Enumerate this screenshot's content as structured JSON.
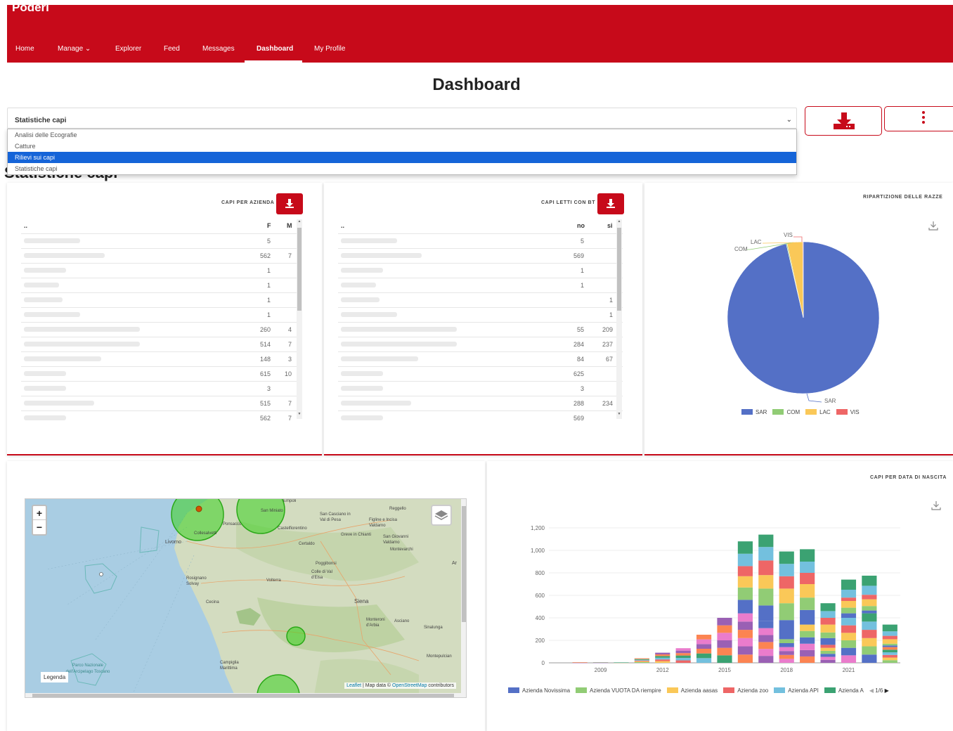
{
  "app": {
    "brand": "Poderi"
  },
  "nav": {
    "items": [
      {
        "label": "Home"
      },
      {
        "label": "Manage"
      },
      {
        "label": "Explorer"
      },
      {
        "label": "Feed"
      },
      {
        "label": "Messages"
      },
      {
        "label": "Dashboard"
      },
      {
        "label": "My Profile"
      }
    ],
    "manage_chevron": "⌄"
  },
  "page": {
    "title": "Dashboard",
    "section_title": "Statistiche capi"
  },
  "selector": {
    "value": "Statistiche capi",
    "chevron": "⌄",
    "options": [
      "Analisi delle Ecografie",
      "Catture",
      "Rilievi sui capi",
      "Statistiche capi"
    ],
    "highlighted": "Rilievi sui capi"
  },
  "colors": {
    "primary": "#c70a1a",
    "selection": "#1564d8"
  },
  "table_azienda": {
    "title": "CAPI PER AZIENDA",
    "col_name": "..",
    "col1": "F",
    "col2": "M",
    "rows": [
      [
        "5",
        ""
      ],
      [
        "562",
        "7"
      ],
      [
        "1",
        ""
      ],
      [
        "1",
        ""
      ],
      [
        "1",
        ""
      ],
      [
        "1",
        ""
      ],
      [
        "260",
        "4"
      ],
      [
        "514",
        "7"
      ],
      [
        "148",
        "3"
      ],
      [
        "615",
        "10"
      ],
      [
        "3",
        ""
      ],
      [
        "515",
        "7"
      ],
      [
        "562",
        "7"
      ]
    ]
  },
  "table_bt": {
    "title": "CAPI LETTI CON BT",
    "col_name": "..",
    "col1": "no",
    "col2": "si",
    "rows": [
      [
        "5",
        ""
      ],
      [
        "569",
        ""
      ],
      [
        "1",
        ""
      ],
      [
        "1",
        ""
      ],
      [
        "",
        "1"
      ],
      [
        "",
        "1"
      ],
      [
        "55",
        "209"
      ],
      [
        "284",
        "237"
      ],
      [
        "84",
        "67"
      ],
      [
        "625",
        ""
      ],
      [
        "3",
        ""
      ],
      [
        "288",
        "234"
      ],
      [
        "569",
        ""
      ]
    ]
  },
  "pie": {
    "title": "RIPARTIZIONE DELLE RAZZE",
    "download_icon": "download-icon"
  },
  "map": {
    "zoom_in": "+",
    "zoom_out": "−",
    "legend_label": "Legenda",
    "attribution_leaflet": "Leaflet",
    "attribution_sep": " | Map data © ",
    "attribution_osm": "OpenStreetMap",
    "attribution_end": " contributors",
    "places": [
      "Empoli",
      "San Miniato",
      "Ponsacco",
      "Castelfiorentino",
      "San Casciano in Val di Pesa",
      "Reggello",
      "Figline e Incisa Valdarno",
      "Greve in Chianti",
      "San Giovanni Valdarno",
      "Montevarchi",
      "Livorno",
      "Collesalvetti",
      "Certaldo",
      "Poggibonsi",
      "Colle di Val d'Elsa",
      "Rosignano Solvay",
      "Volterra",
      "Siena",
      "Cecina",
      "Monteroni d'Arbia",
      "Asciano",
      "Sinalunga",
      "Ar",
      "Campiglia Marittima",
      "Montepulcian",
      "Parco Nazionale dell'Arcipelago Toscano"
    ]
  },
  "chart_data": [
    {
      "type": "pie",
      "title": "RIPARTIZIONE DELLE RAZZE",
      "labels": [
        "SAR",
        "COM",
        "LAC",
        "VIS"
      ],
      "values": [
        2960,
        6,
        101,
        4
      ],
      "colors": [
        "#5470c6",
        "#91cc75",
        "#fac858",
        "#ee6666"
      ],
      "legend": "bottom"
    },
    {
      "type": "bar",
      "stacked": true,
      "title": "CAPI PER DATA DI NASCITA",
      "x": [
        "2007",
        "2008",
        "2009",
        "2010",
        "2011",
        "2012",
        "2013",
        "2014",
        "2015",
        "2016",
        "2017",
        "2018",
        "2019",
        "2020",
        "2021",
        "2022",
        "2023"
      ],
      "xticks": [
        "2009",
        "2012",
        "2015",
        "2018",
        "2021"
      ],
      "ylim": [
        0,
        1200
      ],
      "yticks": [
        "0",
        "200",
        "400",
        "600",
        "800",
        "1,000",
        "1,200"
      ],
      "legend_page": "1/6",
      "series": [
        {
          "name": "Azienda  Novissima",
          "color": "#5470c6",
          "values": [
            0,
            0,
            0,
            0,
            0,
            0,
            0,
            0,
            0,
            120,
            140,
            170,
            130,
            60,
            40,
            25,
            15
          ]
        },
        {
          "name": "Azienda  VUOTA DA riempire",
          "color": "#91cc75",
          "values": [
            0,
            0,
            0,
            0,
            0,
            0,
            0,
            0,
            0,
            110,
            150,
            150,
            110,
            50,
            50,
            40,
            15
          ]
        },
        {
          "name": "Azienda  aasas",
          "color": "#fac858",
          "values": [
            0,
            0,
            0,
            0,
            0,
            0,
            0,
            0,
            0,
            100,
            120,
            130,
            120,
            70,
            60,
            60,
            40
          ]
        },
        {
          "name": "Azienda  zoo",
          "color": "#ee6666",
          "values": [
            0,
            0,
            0,
            0,
            0,
            0,
            0,
            0,
            0,
            90,
            130,
            110,
            100,
            60,
            30,
            40,
            30
          ]
        },
        {
          "name": "Azienda  API",
          "color": "#73c0de",
          "values": [
            0,
            0,
            0,
            0,
            0,
            0,
            0,
            0,
            0,
            110,
            120,
            110,
            100,
            60,
            70,
            80,
            40
          ]
        },
        {
          "name": "Azienda  A",
          "color": "#3ba272",
          "values": [
            0,
            0,
            0,
            0,
            0,
            0,
            0,
            0,
            0,
            110,
            110,
            110,
            110,
            70,
            90,
            90,
            60
          ]
        }
      ],
      "remainder": [
        0,
        5,
        6,
        4,
        40,
        90,
        130,
        250,
        400,
        440,
        370,
        210,
        340,
        160,
        400,
        440,
        140
      ],
      "remainder_colors": [
        "#fc8452",
        "#9a60b4",
        "#ea7ccc",
        "#5470c6",
        "#91cc75",
        "#fac858",
        "#ee6666",
        "#73c0de",
        "#3ba272",
        "#fc8452",
        "#9a60b4",
        "#ea7ccc"
      ]
    }
  ],
  "bar_chart": {
    "title": "CAPI PER DATA DI NASCITA",
    "download_icon": "download-icon"
  }
}
